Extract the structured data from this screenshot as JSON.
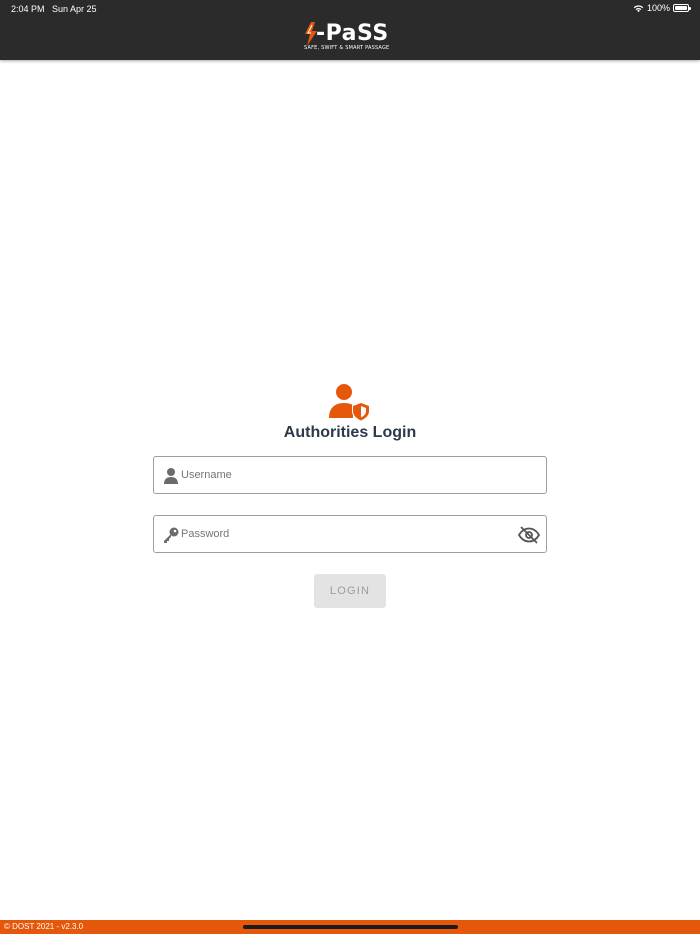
{
  "status_bar": {
    "time": "2:04 PM",
    "date": "Sun Apr 25",
    "battery": "100%"
  },
  "header": {
    "logo_word": "-PaSS",
    "logo_tagline": "Safe, Swift & Smart Passage"
  },
  "login": {
    "title": "Authorities Login",
    "username_placeholder": "Username",
    "password_placeholder": "Password",
    "login_button": "LOGIN"
  },
  "footer": {
    "copyright": "© DOST 2021 - v2.3.0"
  },
  "colors": {
    "accent": "#e5570a",
    "header_bg": "#2b2b2b",
    "title_text": "#2c3a4b",
    "button_disabled_bg": "#e3e3e3"
  },
  "icons": {
    "wifi": "wifi-icon",
    "battery": "battery-icon",
    "login": "user-shield-icon",
    "username": "user-icon",
    "password": "key-icon",
    "toggle_visibility": "eye-off-icon"
  }
}
